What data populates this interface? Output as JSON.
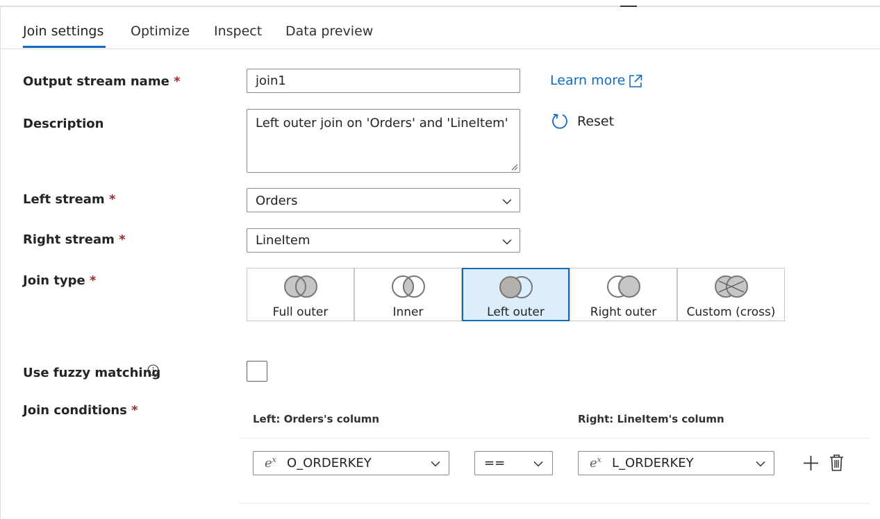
{
  "tabs": [
    {
      "label": "Join settings",
      "active": true
    },
    {
      "label": "Optimize",
      "active": false
    },
    {
      "label": "Inspect",
      "active": false
    },
    {
      "label": "Data preview",
      "active": false
    }
  ],
  "form": {
    "required_marker": "*",
    "output_stream": {
      "label": "Output stream name",
      "value": "join1"
    },
    "description": {
      "label": "Description",
      "value": "Left outer join on 'Orders' and 'LineItem'"
    },
    "left_stream": {
      "label": "Left stream",
      "value": "Orders"
    },
    "right_stream": {
      "label": "Right stream",
      "value": "LineItem"
    },
    "join_type": {
      "label": "Join type",
      "selected": "Left outer",
      "options": [
        "Full outer",
        "Inner",
        "Left outer",
        "Right outer",
        "Custom (cross)"
      ]
    },
    "fuzzy": {
      "label": "Use fuzzy matching",
      "checked": false
    },
    "join_conditions": {
      "label": "Join conditions",
      "left_header": "Left: Orders's column",
      "right_header": "Right: LineItem's column",
      "rows": [
        {
          "left_column": "O_ORDERKEY",
          "operator": "==",
          "right_column": "L_ORDERKEY"
        }
      ]
    }
  },
  "links": {
    "learn_more": "Learn more",
    "reset": "Reset"
  },
  "icons": {
    "external_link": "external-link-icon",
    "reset": "reset-icon",
    "info": "info-icon",
    "expression": "expression-icon",
    "chevron": "chevron-down-icon",
    "add": "plus-icon",
    "delete": "trash-icon"
  },
  "colors": {
    "accent": "#0f6cbd",
    "selected_bg": "#dcedfc",
    "required": "#a4262c"
  }
}
